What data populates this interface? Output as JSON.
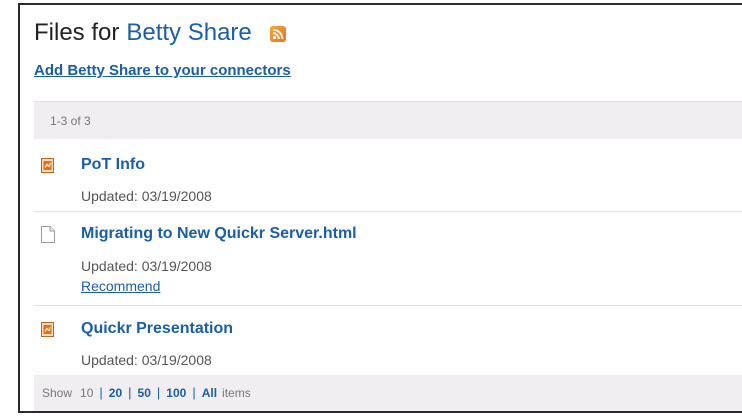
{
  "header": {
    "title_prefix": "Files for",
    "owner": "Betty Share",
    "rss_icon": "rss-feed-icon",
    "add_connector_label": "Add Betty Share to your connectors"
  },
  "count_label": "1-3 of 3",
  "files": [
    {
      "name": "PoT Info",
      "icon": "presentation-file-icon",
      "updated": "Updated: 03/19/2008"
    },
    {
      "name": "Migrating to New Quickr Server.html",
      "icon": "document-file-icon",
      "updated": "Updated: 03/19/2008",
      "recommend": "Recommend"
    },
    {
      "name": "Quickr Presentation",
      "icon": "presentation-file-icon",
      "updated": "Updated: 03/19/2008"
    }
  ],
  "pager": {
    "show_label": "Show",
    "current": "10",
    "options": [
      "20",
      "50",
      "100",
      "All"
    ],
    "items_label": "items"
  },
  "colors": {
    "link": "#1a5ea8",
    "bar_bg": "#f1eef1",
    "text_muted": "#777777"
  }
}
